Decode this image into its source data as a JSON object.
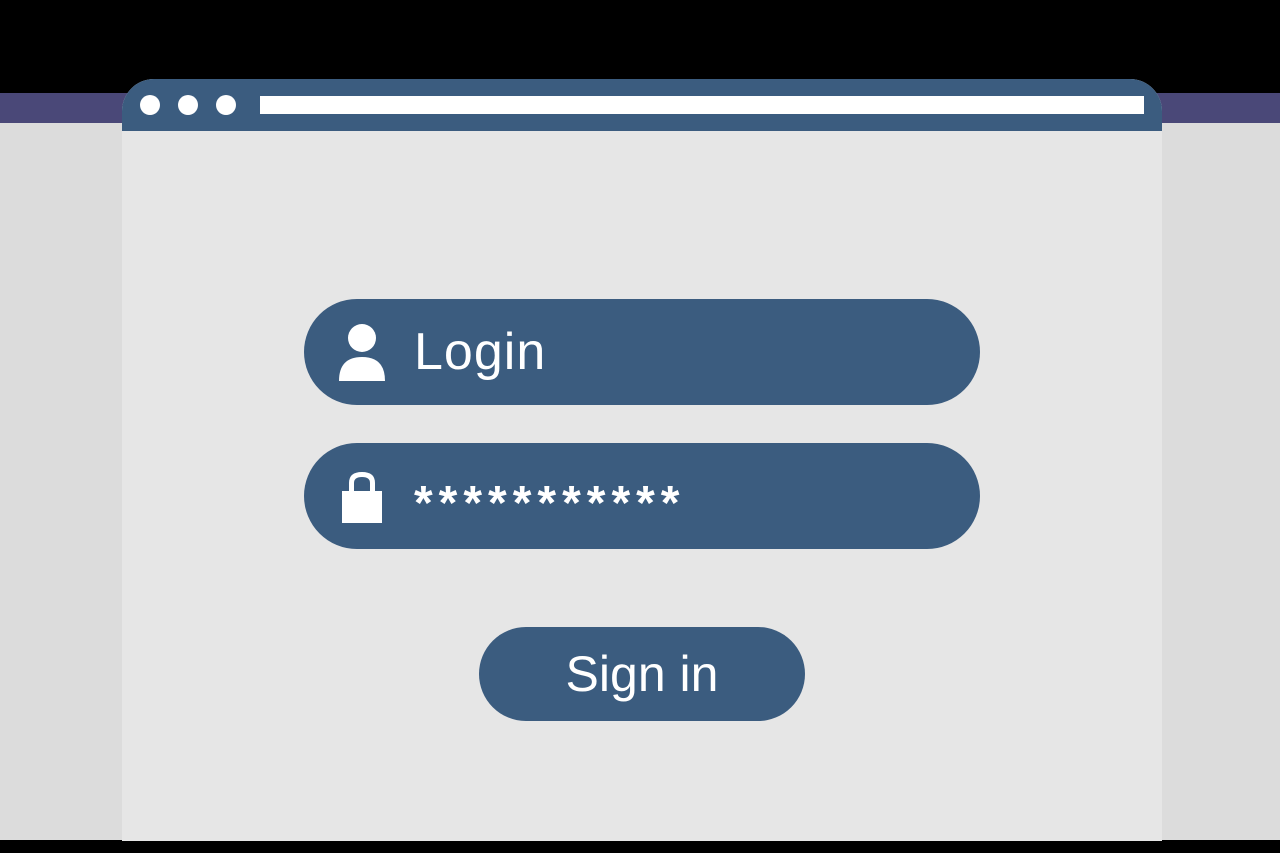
{
  "login": {
    "username_placeholder": "Login",
    "password_value": "***********",
    "signin_label": "Sign in"
  },
  "colors": {
    "accent": "#3b5c7f",
    "background": "#e6e6e6",
    "outer": "#dcdcdc",
    "bar": "#4a4878"
  }
}
